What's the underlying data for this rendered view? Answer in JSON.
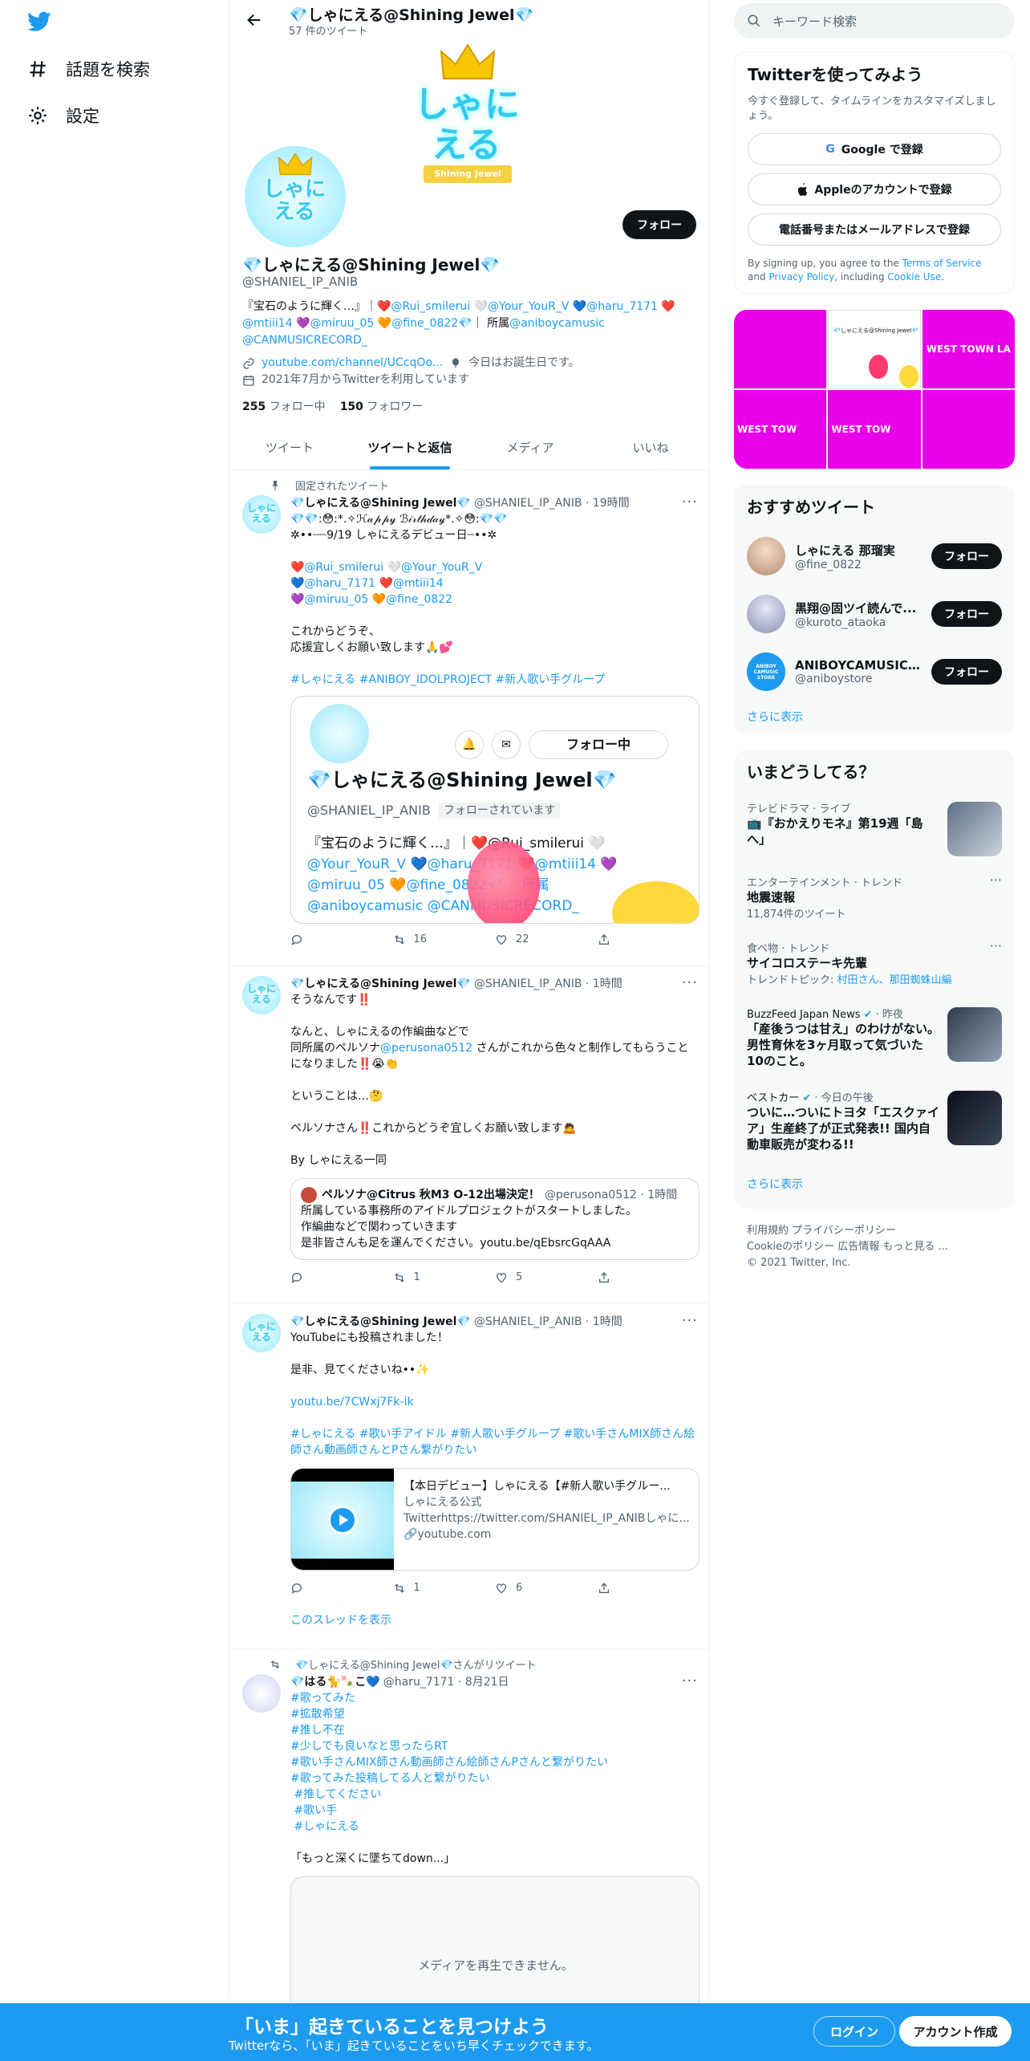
{
  "nav": {
    "logo": "twitter-bird",
    "explore_label": "話題を検索",
    "settings_label": "設定"
  },
  "header": {
    "name": "💎しゃにえる@Shining Jewel💎",
    "tweet_count": "57 件のツイート"
  },
  "profile": {
    "avatar_text": "しゃにえる",
    "banner_text_top": "しゃに",
    "banner_text_bottom": "える",
    "banner_ribbon": "Shining Jewel",
    "follow_label": "フォロー",
    "name": "💎しゃにえる@Shining Jewel💎",
    "handle": "@SHANIEL_IP_ANIB",
    "bio_plain_1": "『宝石のように輝く…』｜❤️",
    "bio_link_1": "@Rui_smilerui",
    "bio_plain_2": " 🤍",
    "bio_link_2": "@Your_YouR_V",
    "bio_plain_3": " 💙",
    "bio_link_3": "@haru_7171",
    "bio_plain_4": " ❤️",
    "bio_link_4": "@mtiii14",
    "bio_plain_5": " 💜",
    "bio_link_5": "@miruu_05",
    "bio_plain_6": " 🧡",
    "bio_link_6": "@fine_0822",
    "bio_plain_7": "💎｜ 所属",
    "bio_link_7": "@aniboycamusic",
    "bio_link_8": "@CANMUSICRECORD_",
    "url": "youtube.com/channel/UCcqOo...",
    "birthday": "今日はお誕生日です。",
    "joined": "2021年7月からTwitterを利用しています",
    "following_count": "255",
    "following_label": "フォロー中",
    "followers_count": "150",
    "followers_label": "フォロワー"
  },
  "tabs": [
    "ツイート",
    "ツイートと返信",
    "メディア",
    "いいね"
  ],
  "tweets": [
    {
      "context": "固定されたツイート",
      "name": "💎しゃにえる@Shining Jewel💎",
      "meta": "@SHANIEL_IP_ANIB · 19時間",
      "line1": "💎💎:😳:*.✧ℋ𝒶𝓅𝓅𝓎 ℬ𝒾𝓇𝓉𝒽𝒹𝒶𝓎*.✧😳:💎💎",
      "line2": "✲••┈┈9/19 しゃにえるデビュー日┈••✲",
      "m1": "❤️@Rui_smilerui 🤍@Your_YouR_V",
      "m2": "💙@haru_7171 ❤️@mtiii14",
      "m3": "💜@miruu_05 🧡@fine_0822",
      "line3": "これからどうぞ、",
      "line4": "応援宜しくお願い致します🙏💕",
      "hashtags": "#しゃにえる #ANIBOY_IDOLPROJECT #新人歌い手グループ",
      "card_name": "💎しゃにえる@Shining Jewel💎",
      "card_handle": "@SHANIEL_IP_ANIB",
      "card_follows_you": "フォローされています",
      "card_following_btn": "フォロー中",
      "card_bio_1": "『宝石のように輝く…』｜❤️@Rui_smilerui 🤍",
      "card_bio_2": "@Your_YouR_V 💙@haru_7171 ❤️@mtiii14 💜",
      "card_bio_3": "@miruu_05 🧡@fine_0822💎｜ 所属",
      "card_bio_4": "@aniboycamusic @CANMUSICRECORD_",
      "retweets": "16",
      "likes": "22"
    },
    {
      "name": "💎しゃにえる@Shining Jewel💎",
      "meta": "@SHANIEL_IP_ANIB · 1時間",
      "line1": "そうなんです‼️",
      "line2": "なんと、しゃにえるの作編曲などで",
      "line3a": "同所属のペルソナ",
      "line3b": "@perusona0512",
      "line3c": " さんがこれから色々と制作してもらうことになりました‼️😭👏",
      "line4": "ということは…🤔",
      "line5": "ペルソナさん‼️これからどうぞ宜しくお願い致します🙇",
      "line6": "By しゃにえる一同",
      "quote_name": "ペルソナ@Citrus 秋M3 O-12出場決定！",
      "quote_meta": "@perusona0512 · 1時間",
      "quote_1": "所属している事務所のアイドルプロジェクトがスタートしました。",
      "quote_2": "作編曲などで関わっていきます",
      "quote_3": "是非皆さんも足を運んでください。youtu.be/qEbsrcGqAAA",
      "retweets": "1",
      "likes": "5"
    },
    {
      "name": "💎しゃにえる@Shining Jewel💎",
      "meta": "@SHANIEL_IP_ANIB · 1時間",
      "line1": "YouTubeにも投稿されました！",
      "line2": "是非、見てくださいね••✨",
      "link": "youtu.be/7CWxj7Fk-ik",
      "hashtags": "#しゃにえる #歌い手アイドル #新人歌い手グループ #歌い手さんMIX師さん絵師さん動画師さんとPさん繋がりたい",
      "card_title": "【本日デビュー】しゃにえる【#新人歌い手グルー...",
      "card_channel": "しゃにえる公式",
      "card_desc": "Twitterhttps://twitter.com/SHANIEL_IP_ANIBしゃに...",
      "card_domain": "youtube.com",
      "retweets": "1",
      "likes": "6",
      "thread_link": "このスレッドを表示"
    },
    {
      "context": "💎しゃにえる@Shining Jewel💎さんがリツイート",
      "name": "💎はる🐈🍡こ💙",
      "meta": "@haru_7171 · 8月21日",
      "tags": [
        "#歌ってみた",
        "#拡散希望",
        "#推し不在",
        "#少しでも良いなと思ったらRT",
        "#歌い手さんMIX師さん動画師さん絵師さんPさんと繋がりたい",
        "#歌ってみた投稿してる人と繋がりたい",
        " #推してください",
        " #歌い手",
        " #しゃにえる"
      ],
      "line1": "「もっと深くに墜ちてdown...」",
      "media_error": "メディアを再生できません。"
    }
  ],
  "search": {
    "placeholder": "キーワード検索"
  },
  "signup": {
    "title": "Twitterを使ってみよう",
    "subtitle": "今すぐ登録して、タイムラインをカスタマイズしましょう。",
    "google": "Google で登録",
    "apple": "Appleのアカウントで登録",
    "phone": "電話番号またはメールアドレスで登録",
    "terms_1": "By signing up, you agree to the ",
    "terms_link_1": "Terms of Service",
    "terms_2": " and ",
    "terms_link_2": "Privacy Policy",
    "terms_3": ", including ",
    "terms_link_3": "Cookie Use",
    "terms_4": "."
  },
  "media_grid": {
    "label_1": "WEST TOWN LA",
    "label_2": "WEST TOW",
    "label_3": "WEST TOW",
    "mini_name": "💎しゃにえる@Shining Jewel💎",
    "accent": "#e800e8"
  },
  "recommended": {
    "title": "おすすめツイート",
    "users": [
      {
        "name": "しゃにえる 那瑠実",
        "handle": "@fine_0822",
        "button": "フォロー"
      },
      {
        "name": "黒翔@固ツイ読んで...",
        "handle": "@kuroto_ataoka",
        "button": "フォロー"
      },
      {
        "name": "ANIBOYCAMUSIC ST...",
        "handle": "@aniboystore",
        "button": "フォロー",
        "avatar_text": "ANIBOY CAMUSIC STORE"
      }
    ],
    "more": "さらに表示"
  },
  "trends": {
    "title": "いまどうしてる？",
    "items": [
      {
        "category": "テレビドラマ · ライブ",
        "title": "📺『おかえりモネ』第19週「島へ」"
      },
      {
        "category": "エンターテインメント · トレンド",
        "title": "地震速報",
        "sub": "11,874件のツイート"
      },
      {
        "category": "食べ物 · トレンド",
        "title": "サイコロステーキ先輩",
        "sub_prefix": "トレンドトピック: ",
        "sub_link": "村田さん、那田蜘蛛山編"
      },
      {
        "category_source": "BuzzFeed Japan News",
        "category_time": " · 昨夜",
        "title": "「産後うつは甘え」のわけがない。男性育休を3ヶ月取って気づいた10のこと。"
      },
      {
        "category_source": "ベストカー",
        "category_time": " · 今日の午後",
        "title": "ついに…ついにトヨタ「エスクァイア」生産終了が正式発表!! 国内自動車販売が変わる!!"
      }
    ],
    "more": "さらに表示"
  },
  "footer": {
    "links_1": "利用規約   プライバシーポリシー",
    "links_2": "Cookieのポリシー   広告情報   もっと見る ...",
    "copyright": "© 2021 Twitter, Inc."
  },
  "bottom_bar": {
    "title": "「いま」起きていることを見つけよう",
    "subtitle": "Twitterなら、「いま」起きていることをいち早くチェックできます。",
    "login": "ログイン",
    "signup": "アカウント作成"
  },
  "colors": {
    "brand": "#1d9bf0",
    "text": "#0f1419",
    "secondary": "#536471"
  }
}
